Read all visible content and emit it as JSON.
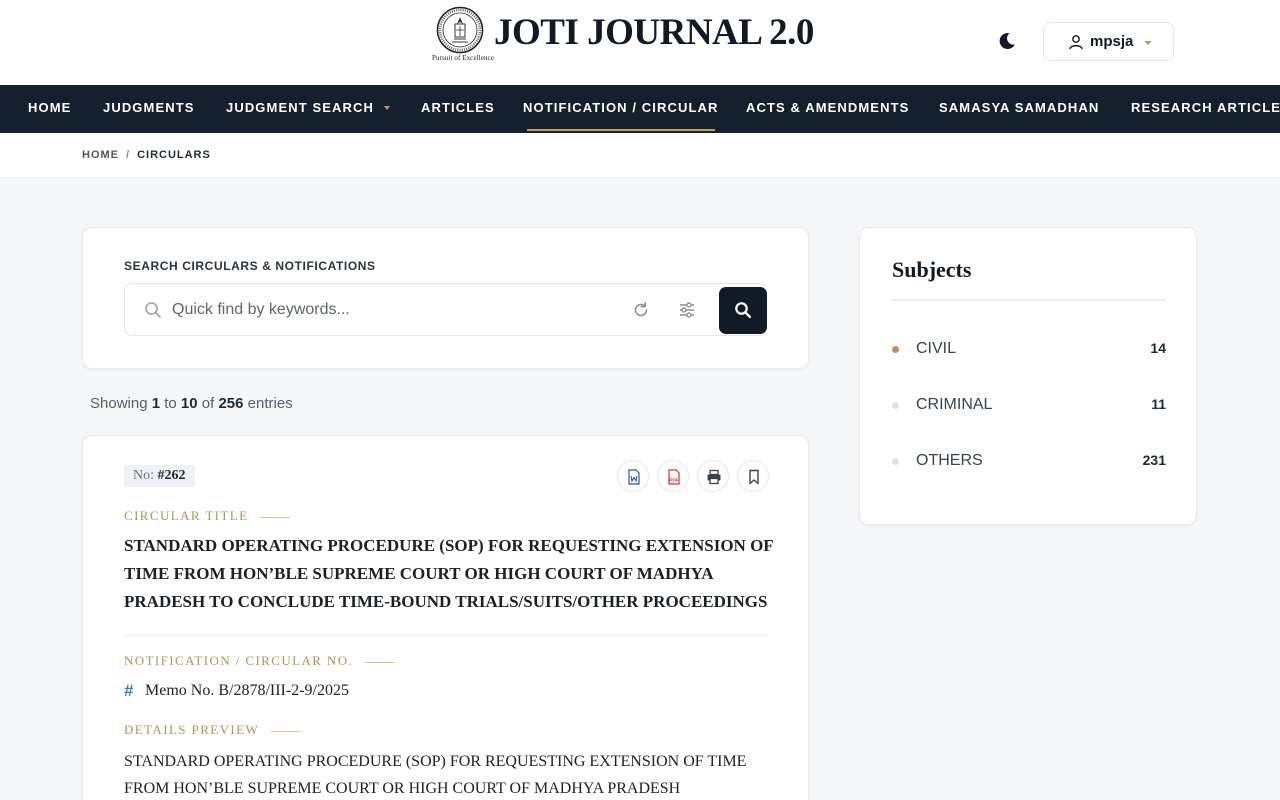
{
  "header": {
    "logo_tagline": "Pursuit of Excellence",
    "title": "JOTI JOURNAL 2.0",
    "theme_icon": "moon-icon",
    "user": {
      "name": "mpsja",
      "icon": "user-icon"
    }
  },
  "nav": {
    "items": [
      {
        "label": "HOME"
      },
      {
        "label": "JUDGMENTS"
      },
      {
        "label": "JUDGMENT SEARCH"
      },
      {
        "label": "ARTICLES"
      },
      {
        "label": "NOTIFICATION / CIRCULAR"
      },
      {
        "label": "ACTS & AMENDMENTS"
      },
      {
        "label": "SAMASYA SAMADHAN"
      },
      {
        "label": "RESEARCH ARTICLES"
      }
    ],
    "active": "NOTIFICATION / CIRCULAR"
  },
  "breadcrumb": {
    "home": "HOME",
    "separator": "/",
    "current": "CIRCULARS"
  },
  "search": {
    "label": "SEARCH CIRCULARS & NOTIFICATIONS",
    "placeholder": "Quick find by keywords...",
    "value": ""
  },
  "results": {
    "prefix": "Showing",
    "from": "1",
    "to_word": "to",
    "to": "10",
    "of_word": "of",
    "total": "256",
    "suffix": "entries"
  },
  "circular": {
    "no_label": "No:",
    "number": "#262",
    "title_label": "CIRCULAR TITLE",
    "title": "STANDARD OPERATING PROCEDURE (SOP) FOR REQUESTING EXTENSION OF TIME FROM HON’BLE SUPREME COURT OR HIGH COURT OF MADHYA PRADESH TO CONCLUDE TIME-BOUND TRIALS/SUITS/OTHER PROCEEDINGS",
    "ref_label": "NOTIFICATION / CIRCULAR NO.",
    "ref_hash": "#",
    "ref": "Memo No. B/2878/III-2-9/2025",
    "preview_label": "DETAILS PREVIEW",
    "preview": "STANDARD OPERATING PROCEDURE (SOP) FOR REQUESTING EXTENSION OF TIME FROM HON’BLE SUPREME COURT OR HIGH COURT OF MADHYA PRADESH",
    "actions": [
      "word-doc-icon",
      "pdf-icon",
      "print-icon",
      "bookmark-icon"
    ]
  },
  "subjects": {
    "title": "Subjects",
    "items": [
      {
        "label": "CIVIL",
        "count": "14"
      },
      {
        "label": "CRIMINAL",
        "count": "11"
      },
      {
        "label": "OTHERS",
        "count": "231"
      }
    ],
    "active": "CIVIL"
  },
  "colors": {
    "nav_bg": "#14202e",
    "accent_gold": "#b8924f",
    "search_button": "#111b27",
    "page_bg": "#f4f6f8"
  }
}
